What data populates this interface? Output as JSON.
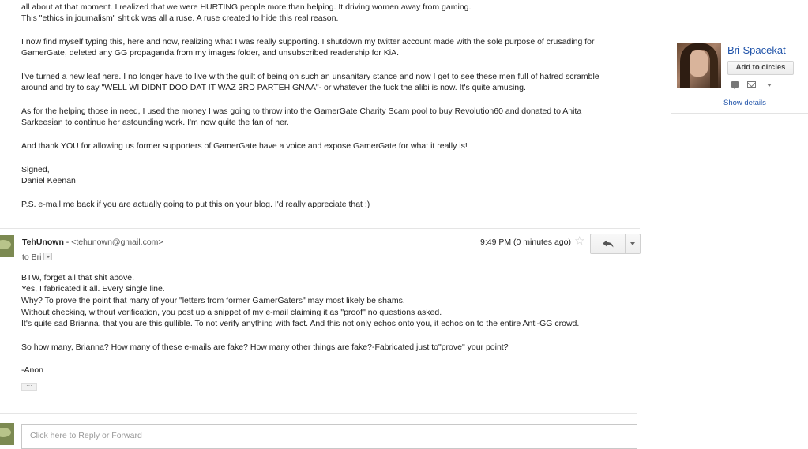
{
  "message1": {
    "lines": [
      "all about at that moment. I realized that we were HURTING people more than helping. It driving women away from gaming.",
      "This \"ethics in journalism\" shtick was all a ruse. A ruse created to hide this real reason.",
      "I now find myself typing this, here and now, realizing what I was really supporting. I shutdown my twitter account made with the sole purpose of crusading for",
      "GamerGate, deleted any GG propaganda from my images folder, and unsubscribed readership for KiA.",
      "I've turned a new leaf here. I no longer have to live with the guilt of being on such an unsanitary stance and now I get to see these men full of hatred scramble",
      "around and try to say \"WELL WI DIDNT DOO DAT IT WAZ  3RD PARTEH GNAA\"- or whatever the fuck the alibi is now. It's quite amusing.",
      "As for the helping those in need, I used the money I was going to throw into the GamerGate Charity Scam pool to buy Revolution60 and donated to Anita",
      "Sarkeesian to continue her astounding work. I'm now quite the fan of her.",
      "And thank YOU for allowing us former supporters of GamerGate have a voice and expose GamerGate for what it really is!",
      "Signed,",
      "Daniel Keenan",
      "P.S. e-mail me back if you are actually going to put this on your blog. I'd really appreciate that :)"
    ]
  },
  "message2": {
    "sender_name": "TehUnown",
    "sender_separator": " - ",
    "sender_email": "<tehunown@gmail.com>",
    "to_label": "to Bri",
    "timestamp": "9:49 PM (0 minutes ago)",
    "lines": [
      "BTW, forget all that shit above.",
      "Yes, I fabricated it all. Every single line.",
      "Why? To prove the point that many of your \"letters from former GamerGaters\" may most likely be shams.",
      "Without checking, without verification, you post up a snippet of my e-mail claiming it as \"proof\" no questions asked.",
      "It's quite sad Brianna, that you are this gullible. To not verify anything with fact. And this not only echos onto you, it echos on to the entire Anti-GG crowd.",
      "So how many, Brianna? How many of these e-mails are fake? How many other things are fake?-Fabricated just to\"prove\" your point?",
      "-Anon"
    ]
  },
  "reply": {
    "placeholder": "Click here to Reply or Forward"
  },
  "profile": {
    "name": "Bri Spacekat",
    "add_button": "Add to circles",
    "show_details": "Show details"
  },
  "icons": {
    "star": "star-icon",
    "reply": "reply-arrow-icon",
    "more": "chevron-down-icon",
    "chat": "chat-icon",
    "mail": "mail-icon"
  }
}
